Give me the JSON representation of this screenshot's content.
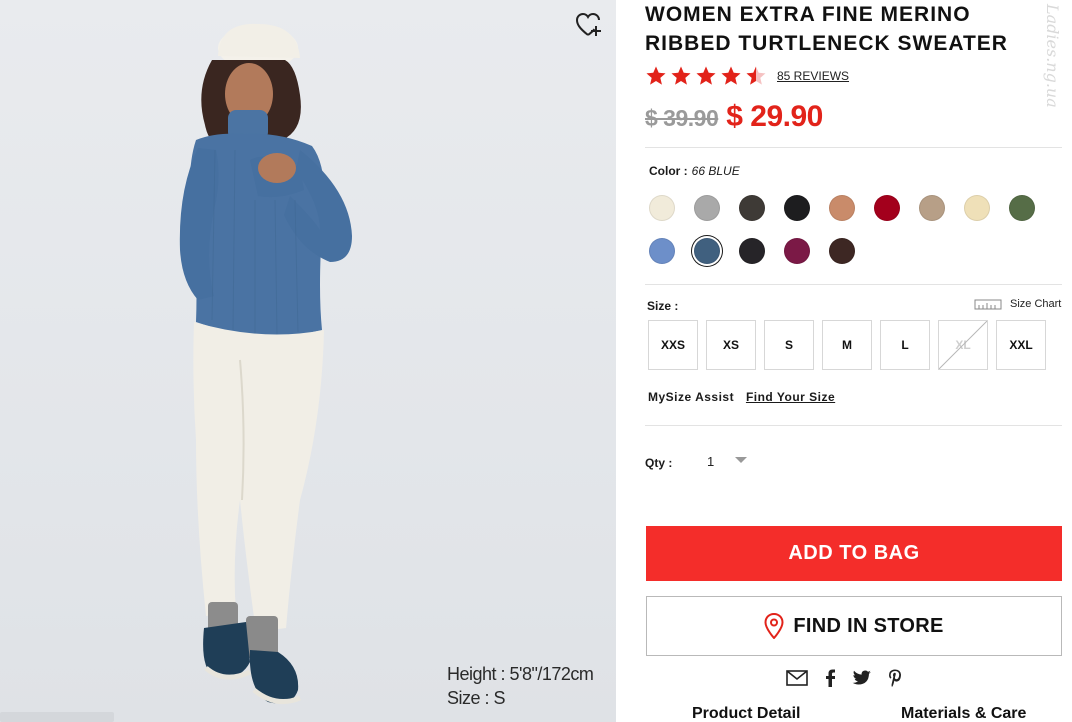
{
  "photo": {
    "caption_height": "Height : 5'8\"/172cm",
    "caption_size": "Size : S",
    "wishlist_icon": "heart-plus-icon"
  },
  "product": {
    "title": "WOMEN EXTRA FINE MERINO RIBBED TURTLENECK SWEATER",
    "rating_stars": 4.5,
    "reviews_label": "85 REVIEWS",
    "price_original": "$ 39.90",
    "price_sale": "$ 29.90",
    "sale_color": "#e2231a",
    "watermark": "Ladies.ng.ua"
  },
  "color": {
    "label": "Color :",
    "selected_value": "66 BLUE",
    "swatches": [
      {
        "name": "off-white",
        "hex": "#f1ebda"
      },
      {
        "name": "gray",
        "hex": "#a9a9a9"
      },
      {
        "name": "dark-olive",
        "hex": "#3e3a36"
      },
      {
        "name": "black",
        "hex": "#1d1d1f"
      },
      {
        "name": "terracotta",
        "hex": "#c98b6a"
      },
      {
        "name": "red",
        "hex": "#a3001c"
      },
      {
        "name": "beige",
        "hex": "#b79f87"
      },
      {
        "name": "cream",
        "hex": "#efe0b8"
      },
      {
        "name": "green",
        "hex": "#566d47"
      },
      {
        "name": "light-blue",
        "hex": "#6d8fc9"
      },
      {
        "name": "blue",
        "hex": "#40607f",
        "selected": true
      },
      {
        "name": "charcoal",
        "hex": "#262428"
      },
      {
        "name": "wine",
        "hex": "#7b1946"
      },
      {
        "name": "dark-brown",
        "hex": "#3d2723"
      }
    ]
  },
  "size": {
    "label": "Size :",
    "chart_label": "Size Chart",
    "options": [
      {
        "label": "XXS",
        "available": true
      },
      {
        "label": "XS",
        "available": true
      },
      {
        "label": "S",
        "available": true
      },
      {
        "label": "M",
        "available": true
      },
      {
        "label": "L",
        "available": true
      },
      {
        "label": "XL",
        "available": false
      },
      {
        "label": "XXL",
        "available": true
      }
    ]
  },
  "mysize": {
    "label": "MySize Assist",
    "link": "Find Your Size"
  },
  "qty": {
    "label": "Qty :",
    "value": "1"
  },
  "actions": {
    "add_to_bag": "ADD TO BAG",
    "add_to_bag_color": "#f42d2a",
    "find_in_store": "FIND IN STORE"
  },
  "share_icons": [
    "mail-icon",
    "facebook-icon",
    "twitter-icon",
    "pinterest-icon"
  ],
  "tabs": {
    "product_detail": "Product Detail",
    "materials_care": "Materials & Care"
  }
}
